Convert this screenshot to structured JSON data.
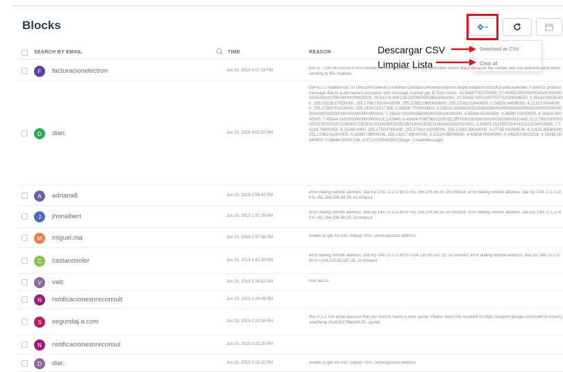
{
  "page": {
    "title": "Blocks"
  },
  "toolbar": {
    "settings_icon": "gear-icon",
    "refresh_icon": "refresh-icon",
    "calendar_icon": "calendar-icon"
  },
  "dropdown": {
    "download_csv": "Download as CSV",
    "clear_all": "Clear all"
  },
  "annotations": {
    "download_csv": "Descargar CSV",
    "clear_list": "Limpiar Lista"
  },
  "table": {
    "header": {
      "email": "SEARCH BY EMAIL",
      "time": "TIME",
      "reason": "REASON"
    },
    "rows": [
      {
        "initial": "F",
        "color": "#5b3fa3",
        "email": "facturacionelectron",
        "time": "Jun 20, 2019 3:07:19 PM",
        "reason": "550 5.7.134 RESOLVER.RST.SenderNotAuthenticated; Delivery restriction check failed because the sender was not authenticated when sending to this mailbox"
      },
      {
        "initial": "D",
        "color": "#2eab52",
        "email": "dian.",
        "time": "Jun 20, 2019 3:02:52 PM",
        "reason": "554 5.2.2 mailbox full; STOREDRV.Deliver.Exception:QuotaExceededException.MapiExceptionShutoffQuotaExceeded; Failed to process message due to a permanent exception with message Cannot get ID from name. 16.55847:0C070000, 17.43559:0000000004A00000000000000000200000000000000000, 20.52176:40FC3870000000003BA3500000, 20.50032:40FC387707702003004E82, 0.35180:80030400, 255.23226:C7020000, 255.27962:0200000000, 255.27962:0600000000, 255.17082:03040000, 0.24929:04006082, 4.21921:00040000, 255.27962:FA000000, 255.1494:02017368, 0.38698:7709000000, 5.29818:0000000030303030360000000000000000000000000000000000000000000000000000000000000, 7.29832:00000000000000000000000000, 4.45884:00040000, 4.29880:00040000, 4.59420:00040000, 7.49544:0100000000000000010C1A0046, 6.45434:F08F060020F00C2EF00000000000000000000000A10480, 5.10786:0000000000313532302E3139383723030313334259415052303140423530313634633353323631, 3.33828:26235572043432323234633345, 7.54218:78800150, 6.25348:0000, 255.1750:F000430, 255.27962:A1000000, 255.17082:89040000, 0.27745:0A000E36, 4.21921:89040000, 255.27962:5e000000, 0.26881:08000036, 255.21817:89040000, 0.37224:8B000000, 4.40808:00040000, 0.24529:03000236, 4.16385:00040000, 0.36864:03001736, 4.37120:00040000 [Stage: CreateMessage]"
      },
      {
        "initial": "A",
        "color": "#6d5fb0",
        "email": "adriana8",
        "time": "Jun 20, 2019 2:59:42 PM",
        "reason": "error dialing remote address: dial tcp 149.72.172.80:0->52.164.206.56:25: i/o timeout; error dialing remote address: dial tcp 149.72.172.80:0->52.164.206.56:25: i/o timeout"
      },
      {
        "initial": "J",
        "color": "#4b6fb5",
        "email": "jhonalbert",
        "time": "Jun 20, 2019 2:57:29 PM",
        "reason": "error dialing remote address: dial tcp 149.72.172.80:0->52.164.206.56:25: i/o timeout; error dialing remote address: dial tcp 149.72.172.80:0->52.164.206.56:25: i/o timeout"
      },
      {
        "initial": "M",
        "color": "#e5824a",
        "email": "miguel.ma",
        "time": "Jun 20, 2019 2:57:06 PM",
        "reason": "unable to get mx info: lookup <nil>: unrecognized address"
      },
      {
        "initial": "C",
        "color": "#8bc34a",
        "email": "castanosoler",
        "time": "Jun 20, 2019 2:41:32 PM",
        "reason": "error dialing remote address: dial tcp 149.72.172.80:0->104.215.95.187:25: i/o timeout; error dialing remote address: dial tcp 149.72.172.80:0->104.215.95.187:25: i/o timeout"
      },
      {
        "initial": "V",
        "color": "#8e6aa0",
        "email": "valc",
        "time": "Jun 20, 2019 2:26:52 PM",
        "reason": "une.net.co"
      },
      {
        "initial": "N",
        "color": "#a01a7a",
        "email": "notificacionesnreconsult",
        "time": "Jun 20, 2019 2:24:09 PM",
        "reason": ""
      },
      {
        "initial": "S",
        "color": "#c2185b",
        "email": "segundaj.a.com",
        "time": "Jun 20, 2019 2:22:34 PM",
        "reason": "452 4.2.2 The email account that you tried to reach is over quota. Please direct the recipient to https://support.google.com/mail/?p=OverQuotaTemp r5si6361746edd129 - gsmtp"
      },
      {
        "initial": "N",
        "color": "#a01a7a",
        "email": "notificacionesnreconsul",
        "time": "Jun 20, 2019 2:21:20 PM",
        "reason": ""
      },
      {
        "initial": "D",
        "color": "#8e6aa0",
        "email": "diar.",
        "time": "Jun 20, 2019 2:21:20 PM",
        "reason": "unable to get mx info: lookup <nil>: unrecognized address"
      }
    ]
  }
}
